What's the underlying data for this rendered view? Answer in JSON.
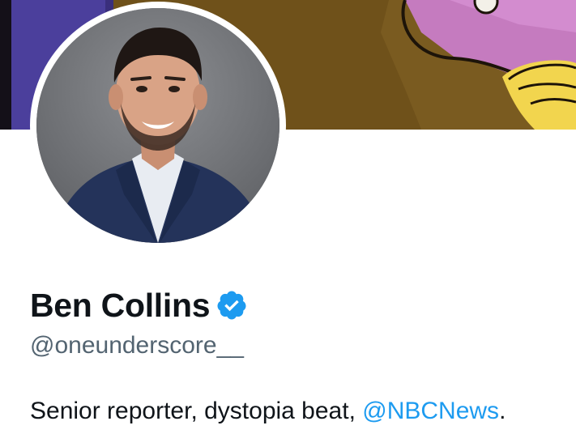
{
  "profile": {
    "display_name": "Ben Collins",
    "handle": "@oneunderscore__",
    "verified": true,
    "bio": {
      "text_before": "Senior reporter, dystopia beat, ",
      "mention": "@NBCNews",
      "text_after": "."
    }
  },
  "colors": {
    "name": "#0f1419",
    "handle": "#536471",
    "link": "#1d9bf0",
    "verified_badge": "#1d9bf0",
    "background": "#ffffff"
  },
  "icons": {
    "verified": "verified-badge-icon"
  }
}
